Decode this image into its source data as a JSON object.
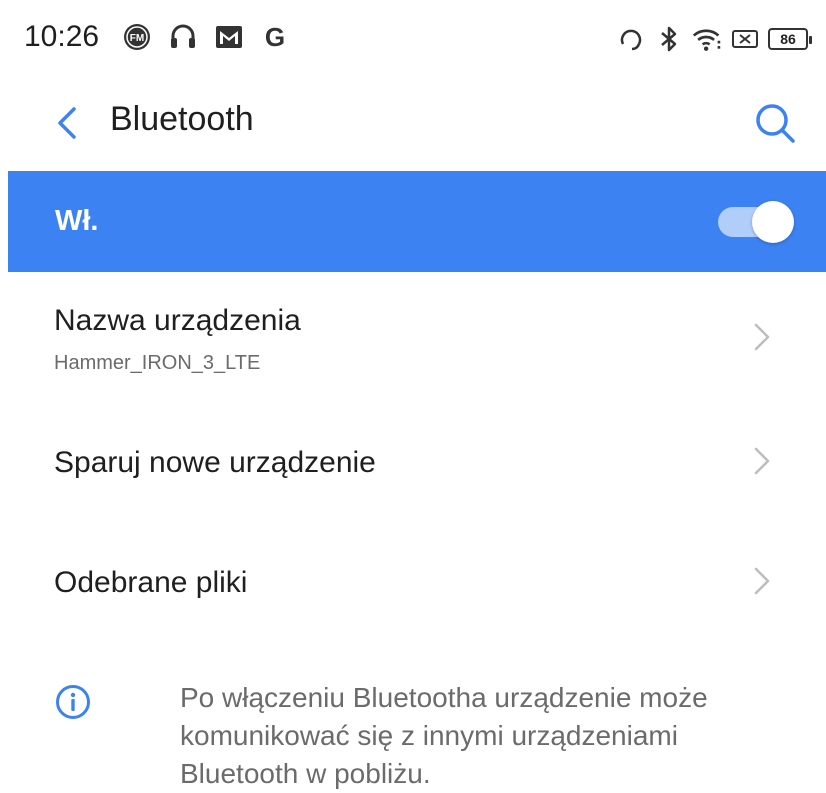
{
  "status_bar": {
    "time": "10:26",
    "left_icons": [
      "fm-radio-icon",
      "headphones-icon",
      "gmail-icon",
      "google-icon"
    ],
    "right_icons": [
      "headset-icon",
      "bluetooth-icon",
      "wifi-icon",
      "no-sim-icon"
    ],
    "battery_level": "86"
  },
  "app_bar": {
    "title": "Bluetooth",
    "back_icon": "chevron-left-icon",
    "search_icon": "search-icon"
  },
  "bluetooth_toggle": {
    "label": "Wł.",
    "state": "on",
    "accent_color": "#3d82f2"
  },
  "settings": {
    "items": [
      {
        "title": "Nazwa urządzenia",
        "subtitle": "Hammer_IRON_3_LTE"
      },
      {
        "title": "Sparuj nowe urządzenie"
      },
      {
        "title": "Odebrane pliki"
      }
    ]
  },
  "info": {
    "icon": "info-icon",
    "text": "Po włączeniu Bluetootha urządzenie może komunikować się z innymi urządzeniami Bluetooth w pobliżu."
  }
}
